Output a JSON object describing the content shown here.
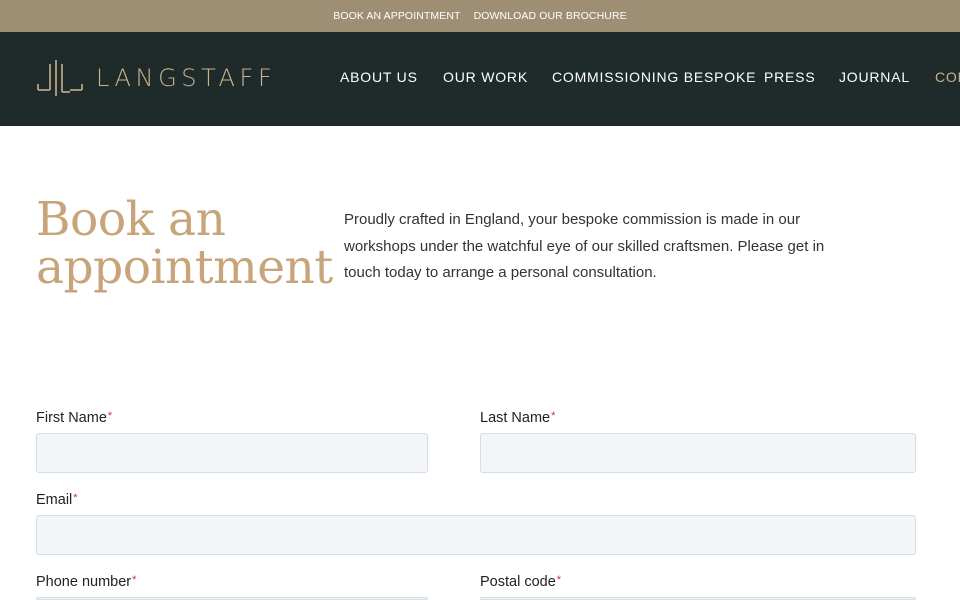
{
  "topbar": {
    "links": [
      "BOOK AN APPOINTMENT",
      "DOWNLOAD OUR BROCHURE"
    ]
  },
  "header": {
    "logo_text": "LANGSTAFF",
    "nav": [
      "ABOUT US",
      "OUR WORK",
      "COMMISSIONING BESPOKE",
      "PRESS",
      "JOURNAL",
      "CONTACT"
    ]
  },
  "hero": {
    "title_line1": "Book an",
    "title_line2": "appointment",
    "intro": "Proudly crafted in England, your bespoke commission is made in our workshops under the watchful eye of our skilled craftsmen. Please get in touch today to arrange a personal consultation."
  },
  "form": {
    "required_mark": "*",
    "first_name_label": "First Name",
    "first_name_value": "",
    "last_name_label": "Last Name",
    "last_name_value": "",
    "email_label": "Email",
    "email_value": "",
    "phone_label": "Phone number",
    "phone_value": "",
    "postal_label": "Postal code",
    "postal_value": ""
  },
  "colors": {
    "topbar": "#9e8f74",
    "header": "#1f2b2a",
    "accent": "#c8a47a",
    "required": "#c0392b"
  }
}
